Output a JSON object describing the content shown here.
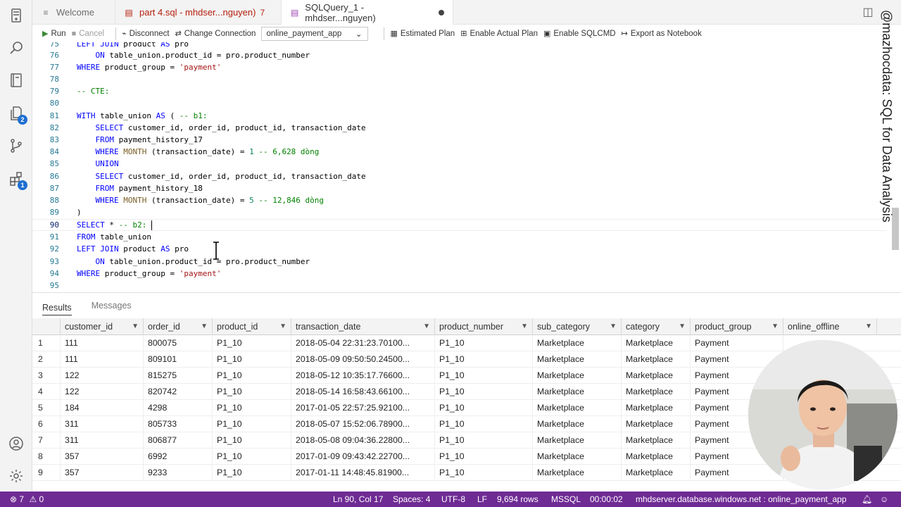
{
  "tabs": [
    {
      "label": "Welcome",
      "icon": "vscode-logo-icon"
    },
    {
      "label": "part 4.sql - mhdser...nguyen)",
      "problems": "7",
      "icon": "error-file-icon"
    },
    {
      "label": "SQLQuery_1 - mhdser...nguyen)",
      "icon": "database-file-icon",
      "unsaved": true
    }
  ],
  "toolbar": {
    "run": "Run",
    "cancel": "Cancel",
    "disconnect": "Disconnect",
    "change_connection": "Change Connection",
    "database": "online_payment_app",
    "estimated_plan": "Estimated Plan",
    "enable_actual_plan": "Enable Actual Plan",
    "enable_sqlcmd": "Enable SQLCMD",
    "export_notebook": "Export as Notebook"
  },
  "editor": {
    "lines": [
      {
        "n": "75",
        "text": "LEFT JOIN product AS pro"
      },
      {
        "n": "76",
        "text": "    ON table_union.product_id = pro.product_number"
      },
      {
        "n": "77",
        "text": "WHERE product_group = 'payment'"
      },
      {
        "n": "78",
        "text": ""
      },
      {
        "n": "79",
        "text": "-- CTE:"
      },
      {
        "n": "80",
        "text": ""
      },
      {
        "n": "81",
        "text": "WITH table_union AS ( -- b1:"
      },
      {
        "n": "82",
        "text": "    SELECT customer_id, order_id, product_id, transaction_date"
      },
      {
        "n": "83",
        "text": "    FROM payment_history_17"
      },
      {
        "n": "84",
        "text": "    WHERE MONTH (transaction_date) = 1 -- 6,628 dòng"
      },
      {
        "n": "85",
        "text": "    UNION"
      },
      {
        "n": "86",
        "text": "    SELECT customer_id, order_id, product_id, transaction_date"
      },
      {
        "n": "87",
        "text": "    FROM payment_history_18"
      },
      {
        "n": "88",
        "text": "    WHERE MONTH (transaction_date) = 5 -- 12,846 dòng"
      },
      {
        "n": "89",
        "text": ")"
      },
      {
        "n": "90",
        "text": "SELECT * -- b2: "
      },
      {
        "n": "91",
        "text": "FROM table_union"
      },
      {
        "n": "92",
        "text": "LEFT JOIN product AS pro"
      },
      {
        "n": "93",
        "text": "    ON table_union.product_id = pro.product_number"
      },
      {
        "n": "94",
        "text": "WHERE product_group = 'payment'"
      },
      {
        "n": "95",
        "text": ""
      }
    ],
    "current_line": "90"
  },
  "results": {
    "tab_results": "Results",
    "tab_messages": "Messages",
    "columns": [
      "customer_id",
      "order_id",
      "product_id",
      "transaction_date",
      "product_number",
      "sub_category",
      "category",
      "product_group",
      "online_offline"
    ],
    "rows": [
      [
        "1",
        "111",
        "800075",
        "P1_10",
        "2018-05-04 22:31:23.70100...",
        "P1_10",
        "Marketplace",
        "Marketplace",
        "Payment"
      ],
      [
        "2",
        "111",
        "809101",
        "P1_10",
        "2018-05-09 09:50:50.24500...",
        "P1_10",
        "Marketplace",
        "Marketplace",
        "Payment"
      ],
      [
        "3",
        "122",
        "815275",
        "P1_10",
        "2018-05-12 10:35:17.76600...",
        "P1_10",
        "Marketplace",
        "Marketplace",
        "Payment"
      ],
      [
        "4",
        "122",
        "820742",
        "P1_10",
        "2018-05-14 16:58:43.66100...",
        "P1_10",
        "Marketplace",
        "Marketplace",
        "Payment"
      ],
      [
        "5",
        "184",
        "4298",
        "P1_10",
        "2017-01-05 22:57:25.92100...",
        "P1_10",
        "Marketplace",
        "Marketplace",
        "Payment"
      ],
      [
        "6",
        "311",
        "805733",
        "P1_10",
        "2018-05-07 15:52:06.78900...",
        "P1_10",
        "Marketplace",
        "Marketplace",
        "Payment"
      ],
      [
        "7",
        "311",
        "806877",
        "P1_10",
        "2018-05-08 09:04:36.22800...",
        "P1_10",
        "Marketplace",
        "Marketplace",
        "Payment"
      ],
      [
        "8",
        "357",
        "6992",
        "P1_10",
        "2017-01-09 09:43:42.22700...",
        "P1_10",
        "Marketplace",
        "Marketplace",
        "Payment"
      ],
      [
        "9",
        "357",
        "9233",
        "P1_10",
        "2017-01-11 14:48:45.81900...",
        "P1_10",
        "Marketplace",
        "Marketplace",
        "Payment"
      ]
    ]
  },
  "status": {
    "errors": "7",
    "warnings": "0",
    "position": "Ln 90, Col 17",
    "spaces": "Spaces: 4",
    "encoding": "UTF-8",
    "eol": "LF",
    "rows": "9,694 rows",
    "language": "MSSQL",
    "elapsed": "00:00:02",
    "connection": "mhdserver.database.windows.net : online_payment_app"
  },
  "watermark": "@mazhocdata: SQL for Data Analysis",
  "colors": {
    "status_bar": "#6f2b94",
    "keyword": "#0000ff",
    "comment": "#008000",
    "string": "#a31515"
  }
}
